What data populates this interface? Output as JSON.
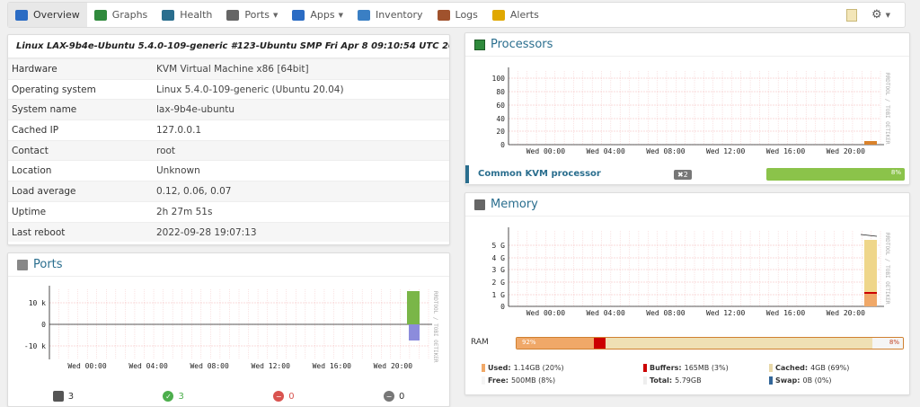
{
  "nav": {
    "items": [
      {
        "label": "Overview",
        "icon": "overview-icon",
        "color": "#2b6cc4",
        "active": true
      },
      {
        "label": "Graphs",
        "icon": "graphs-icon",
        "color": "#2f8a3c"
      },
      {
        "label": "Health",
        "icon": "health-icon",
        "color": "#2a6e8e"
      },
      {
        "label": "Ports",
        "icon": "ports-icon",
        "color": "#666666",
        "caret": true
      },
      {
        "label": "Apps",
        "icon": "apps-icon",
        "color": "#2b6cc4",
        "caret": true
      },
      {
        "label": "Inventory",
        "icon": "inventory-icon",
        "color": "#3a7fc4"
      },
      {
        "label": "Logs",
        "icon": "logs-icon",
        "color": "#a0522d"
      },
      {
        "label": "Alerts",
        "icon": "alerts-icon",
        "color": "#e0a800"
      }
    ]
  },
  "overview": {
    "os_line": "Linux LAX-9b4e-Ubuntu 5.4.0-109-generic #123-Ubuntu SMP Fri Apr 8 09:10:54 UTC 2022 x86_64",
    "rows": [
      {
        "key": "Hardware",
        "value": "KVM Virtual Machine x86 [64bit]"
      },
      {
        "key": "Operating system",
        "value": "Linux 5.4.0-109-generic (Ubuntu 20.04)"
      },
      {
        "key": "System name",
        "value": "lax-9b4e-ubuntu"
      },
      {
        "key": "Cached IP",
        "value": "127.0.0.1"
      },
      {
        "key": "Contact",
        "value": "root"
      },
      {
        "key": "Location",
        "value": "Unknown"
      },
      {
        "key": "Load average",
        "value": "0.12, 0.06, 0.07"
      },
      {
        "key": "Uptime",
        "value": "2h 27m 51s"
      },
      {
        "key": "Last reboot",
        "value": "2022-09-28 19:07:13"
      }
    ]
  },
  "ports": {
    "title": "Ports",
    "graph": {
      "y_ticks": [
        "10 k",
        "0",
        "-10 k"
      ],
      "x_ticks": [
        "Wed 00:00",
        "Wed 04:00",
        "Wed 08:00",
        "Wed 12:00",
        "Wed 16:00",
        "Wed 20:00"
      ],
      "watermark": "RRDTOOL / TOBI OETIKER"
    },
    "counts": [
      {
        "icon": "port-icon",
        "value": "3",
        "color": "#555555"
      },
      {
        "icon": "port-up-icon",
        "value": "3",
        "color": "#4cae4c"
      },
      {
        "icon": "port-down-icon",
        "value": "0",
        "color": "#d9534f"
      },
      {
        "icon": "port-disabled-icon",
        "value": "0",
        "color": "#777777"
      }
    ]
  },
  "processors": {
    "title": "Processors",
    "graph": {
      "y_ticks": [
        "100",
        "80",
        "60",
        "40",
        "20",
        "0"
      ],
      "x_ticks": [
        "Wed 00:00",
        "Wed 04:00",
        "Wed 08:00",
        "Wed 12:00",
        "Wed 16:00",
        "Wed 20:00"
      ],
      "watermark": "RRDTOOL / TOBI OETIKER"
    },
    "row": {
      "name": "Common KVM processor",
      "count": "✖2",
      "percent_label": "8%",
      "percent": 8
    }
  },
  "memory": {
    "title": "Memory",
    "graph": {
      "y_ticks": [
        "5 G",
        "4 G",
        "3 G",
        "2 G",
        "1 G",
        "0"
      ],
      "x_ticks": [
        "Wed 00:00",
        "Wed 04:00",
        "Wed 08:00",
        "Wed 12:00",
        "Wed 16:00",
        "Wed 20:00"
      ],
      "watermark": "RRDTOOL / TOBI OETIKER"
    },
    "ram": {
      "label": "RAM",
      "used_label": "92%",
      "free_label": "8%",
      "used_percent": 20,
      "buffers_percent": 3,
      "cached_percent": 69,
      "free_percent": 8
    },
    "legend": [
      {
        "label": "Used:",
        "value": "1.14GB (20%)",
        "color": "#f0a868"
      },
      {
        "label": "Buffers:",
        "value": "165MB (3%)",
        "color": "#cc0000"
      },
      {
        "label": "Cached:",
        "value": "4GB (69%)",
        "color": "#e8d8a8"
      },
      {
        "label": "Free:",
        "value": "500MB (8%)",
        "color": "#f5f5f5"
      },
      {
        "label": "Total:",
        "value": "5.79GB",
        "color": "#eeeeee"
      },
      {
        "label": "Swap:",
        "value": "0B (0%)",
        "color": "#336699"
      }
    ]
  }
}
